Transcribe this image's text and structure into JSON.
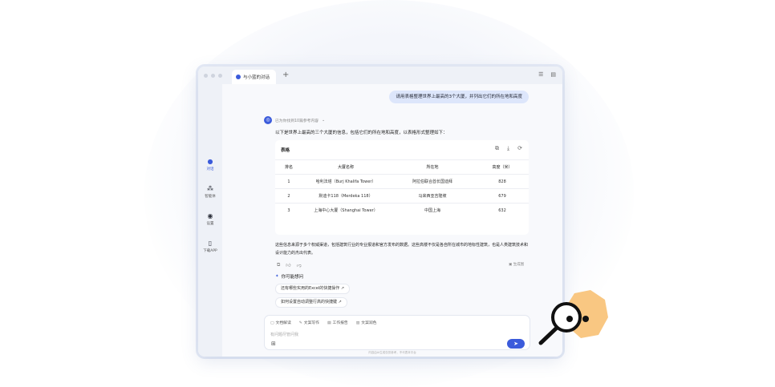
{
  "window": {
    "tab_title": "与小蓝的对话",
    "plus": "+"
  },
  "sidebar": {
    "items": [
      {
        "label": "对话",
        "icon": "chat-icon"
      },
      {
        "label": "智能体",
        "icon": "agents-icon"
      },
      {
        "label": "设置",
        "icon": "settings-icon"
      },
      {
        "label": "下载APP",
        "icon": "phone-icon"
      }
    ]
  },
  "chat": {
    "user_message": "请用表格整理世界上最高的3个大厦，并列出它们的所在地和高度",
    "ai_source_note": "已为你找到10篇参考内容",
    "ai_intro": "以下是世界上最高的三个大厦的信息，包括它们的所在地和高度，以表格形式整理如下：",
    "table_title": "表格",
    "table_headers": [
      "排名",
      "大厦名称",
      "所在地",
      "高度（米）"
    ],
    "table_rows": [
      [
        "1",
        "哈利法塔（Burj Khalifa Tower）",
        "阿拉伯联合酋长国迪拜",
        "828"
      ],
      [
        "2",
        "默迪卡118（Merdeka 118）",
        "马来西亚吉隆坡",
        "679"
      ],
      [
        "3",
        "上海中心大厦（Shanghai Tower）",
        "中国上海",
        "632"
      ]
    ],
    "summary": "这些信息来源于多个权威渠道，包括建筑行业的专业报道和官方发布的数据。这些高楼不仅是各自所在城市的地标性建筑，也是人类建筑技术和设计能力的杰出代表。",
    "export_label": "生成图",
    "maybe_label": "你可能想问",
    "suggestions": [
      "还有哪些实用的Excel的快捷操作 ↗",
      "如何设置自动调整行高的快捷键 ↗"
    ]
  },
  "composer": {
    "quick_actions": [
      "文档解读",
      "文案写作",
      "工作报告",
      "文案润色"
    ],
    "placeholder": "有问题尽管问我",
    "footer_note": "内容由AI生成仅供参考，不代表本平台"
  },
  "colors": {
    "accent": "#3b5bdb",
    "user_bubble": "#dde6fb",
    "mascot": "#f9c782"
  }
}
